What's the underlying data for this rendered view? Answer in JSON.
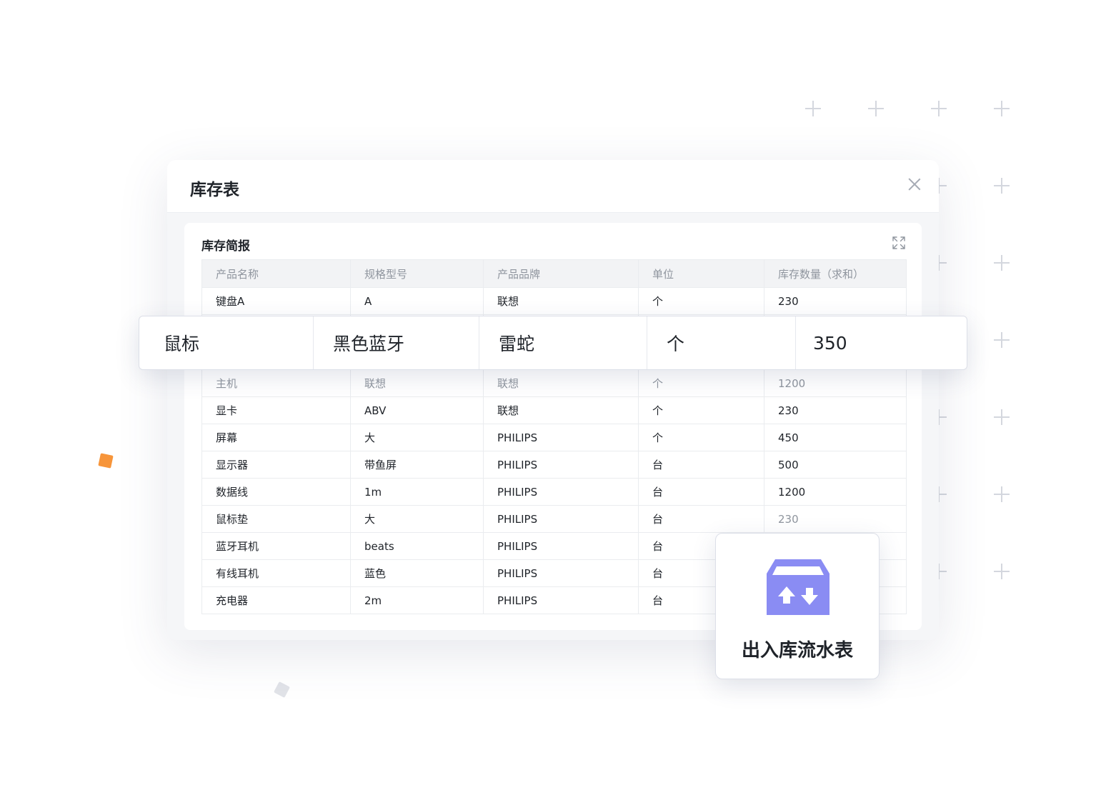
{
  "window": {
    "title": "库存表",
    "card_title": "库存简报",
    "columns": [
      "产品名称",
      "规格型号",
      "产品品牌",
      "单位",
      "库存数量（求和）"
    ],
    "rows": [
      [
        "键盘A",
        "A",
        "联想",
        "个",
        "230"
      ],
      [
        "主机",
        "联想",
        "联想",
        "个",
        "1200"
      ],
      [
        "显卡",
        "ABV",
        "联想",
        "个",
        "230"
      ],
      [
        "屏幕",
        "大",
        "PHILIPS",
        "个",
        "450"
      ],
      [
        "显示器",
        "带鱼屏",
        "PHILIPS",
        "台",
        "500"
      ],
      [
        "数据线",
        "1m",
        "PHILIPS",
        "台",
        "1200"
      ],
      [
        "鼠标垫",
        "大",
        "PHILIPS",
        "台",
        "230"
      ],
      [
        "蓝牙耳机",
        "beats",
        "PHILIPS",
        "台",
        ""
      ],
      [
        "有线耳机",
        "蓝色",
        "PHILIPS",
        "台",
        ""
      ],
      [
        "充电器",
        "2m",
        "PHILIPS",
        "台",
        ""
      ]
    ]
  },
  "highlight_row": [
    "鼠标",
    "黑色蓝牙",
    "雷蛇",
    "个",
    "350"
  ],
  "flow_card": {
    "label": "出入库流水表",
    "icon": "warehouse-in-out-icon",
    "icon_color": "#8a8cf3"
  },
  "colors": {
    "accent": "#8a8cf3",
    "deco_orange": "#f7953a"
  }
}
